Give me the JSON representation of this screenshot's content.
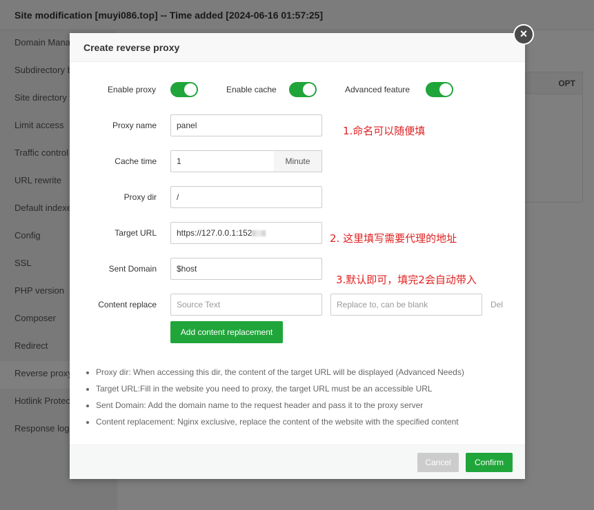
{
  "window": {
    "title": "Site modification [muyi086.top] -- Time added [2024-06-16 01:57:25]"
  },
  "sidebar": {
    "items": [
      {
        "label": "Domain Manag"
      },
      {
        "label": "Subdirectory b"
      },
      {
        "label": "Site directory"
      },
      {
        "label": "Limit access"
      },
      {
        "label": "Traffic control"
      },
      {
        "label": "URL rewrite"
      },
      {
        "label": "Default indexe"
      },
      {
        "label": "Config"
      },
      {
        "label": "SSL"
      },
      {
        "label": "PHP version"
      },
      {
        "label": "Composer"
      },
      {
        "label": "Redirect"
      },
      {
        "label": "Reverse proxy",
        "active": true
      },
      {
        "label": "Hotlink Protec"
      },
      {
        "label": "Response log"
      }
    ]
  },
  "table": {
    "opt_header": "OPT"
  },
  "modal": {
    "title": "Create reverse proxy",
    "close_symbol": "×",
    "toggles": {
      "enable_proxy": {
        "label": "Enable proxy",
        "on": true
      },
      "enable_cache": {
        "label": "Enable cache",
        "on": true
      },
      "advanced_feature": {
        "label": "Advanced feature",
        "on": true
      }
    },
    "fields": {
      "proxy_name": {
        "label": "Proxy name",
        "value": "panel"
      },
      "cache_time": {
        "label": "Cache time",
        "value": "1",
        "unit": "Minute"
      },
      "proxy_dir": {
        "label": "Proxy dir",
        "value": "/"
      },
      "target_url": {
        "label": "Target URL",
        "value": "https://127.0.0.1:152"
      },
      "sent_domain": {
        "label": "Sent Domain",
        "value": "$host"
      },
      "content_replace": {
        "label": "Content replace",
        "source_placeholder": "Source Text",
        "replace_placeholder": "Replace to, can be blank",
        "del_label": "Del"
      }
    },
    "add_replacement_label": "Add content replacement",
    "annotations": {
      "note1": "1.命名可以随便填",
      "note2": "2. 这里填写需要代理的地址",
      "note3": "3.默认即可，填完2会自动带入"
    },
    "tips": [
      "Proxy dir: When accessing this dir, the content of the target URL will be displayed (Advanced Needs)",
      "Target URL:Fill in the website you need to proxy, the target URL must be an accessible URL",
      "Sent Domain: Add the domain name to the request header and pass it to the proxy server",
      "Content replacement: Nginx exclusive, replace the content of the website with the specified content"
    ],
    "buttons": {
      "cancel": "Cancel",
      "confirm": "Confirm"
    }
  },
  "colors": {
    "accent_green": "#20a53a",
    "note_red": "#e02020"
  }
}
